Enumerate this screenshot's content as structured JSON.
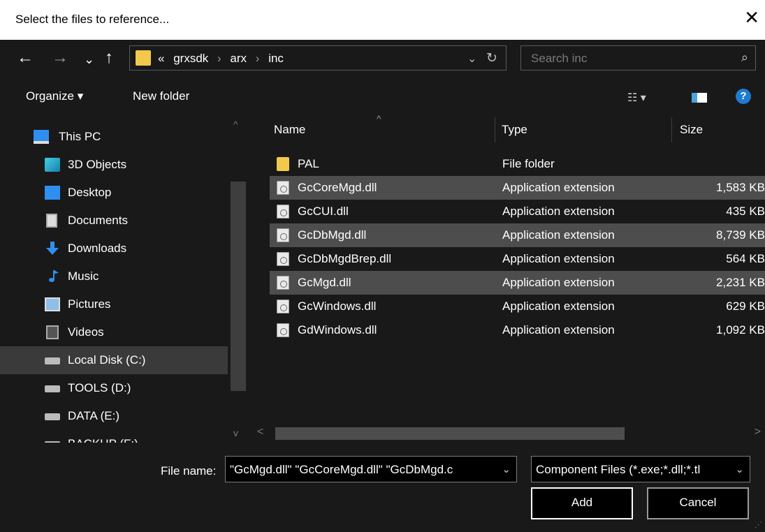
{
  "window": {
    "title": "Select the files to reference...",
    "close_icon": "close-icon"
  },
  "nav": {
    "back": "←",
    "forward": "→",
    "recent": "⌄",
    "up": "↑",
    "address": [
      "«",
      "grxsdk",
      "arx",
      "inc"
    ],
    "address_dropdown": "⌄",
    "refresh": "↻",
    "search_placeholder": "Search inc",
    "search_icon": "⌕"
  },
  "toolbar": {
    "organize": "Organize ▾",
    "new_folder": "New folder",
    "view_menu": "☷ ▾",
    "help": "?"
  },
  "sidebar": {
    "scroll_up": "^",
    "scroll_down": "v",
    "items": [
      {
        "label": "This PC",
        "icon": "computer-icon",
        "selected": false
      },
      {
        "label": "3D Objects",
        "icon": "3d-objects-icon",
        "selected": false
      },
      {
        "label": "Desktop",
        "icon": "desktop-icon",
        "selected": false
      },
      {
        "label": "Documents",
        "icon": "documents-icon",
        "selected": false
      },
      {
        "label": "Downloads",
        "icon": "downloads-icon",
        "selected": false
      },
      {
        "label": "Music",
        "icon": "music-icon",
        "selected": false
      },
      {
        "label": "Pictures",
        "icon": "pictures-icon",
        "selected": false
      },
      {
        "label": "Videos",
        "icon": "videos-icon",
        "selected": false
      },
      {
        "label": "Local Disk (C:)",
        "icon": "drive-icon",
        "selected": true
      },
      {
        "label": "TOOLS (D:)",
        "icon": "drive-icon",
        "selected": false
      },
      {
        "label": "DATA (E:)",
        "icon": "drive-icon",
        "selected": false
      },
      {
        "label": "BACKUP (F:)",
        "icon": "drive-icon",
        "selected": false
      }
    ]
  },
  "files": {
    "sort_indicator": "^",
    "columns": {
      "name": "Name",
      "type": "Type",
      "size": "Size"
    },
    "rows": [
      {
        "name": "PAL",
        "type": "File folder",
        "size": "",
        "icon": "folder-icon",
        "selected": false
      },
      {
        "name": "GcCoreMgd.dll",
        "type": "Application extension",
        "size": "1,583 KB",
        "icon": "dll-file-icon",
        "selected": true
      },
      {
        "name": "GcCUI.dll",
        "type": "Application extension",
        "size": "435 KB",
        "icon": "dll-file-icon",
        "selected": false
      },
      {
        "name": "GcDbMgd.dll",
        "type": "Application extension",
        "size": "8,739 KB",
        "icon": "dll-file-icon",
        "selected": true
      },
      {
        "name": "GcDbMgdBrep.dll",
        "type": "Application extension",
        "size": "564 KB",
        "icon": "dll-file-icon",
        "selected": false
      },
      {
        "name": "GcMgd.dll",
        "type": "Application extension",
        "size": "2,231 KB",
        "icon": "dll-file-icon",
        "selected": true
      },
      {
        "name": "GcWindows.dll",
        "type": "Application extension",
        "size": "629 KB",
        "icon": "dll-file-icon",
        "selected": false
      },
      {
        "name": "GdWindows.dll",
        "type": "Application extension",
        "size": "1,092 KB",
        "icon": "dll-file-icon",
        "selected": false
      }
    ],
    "scroll_left": "<",
    "scroll_right": ">"
  },
  "footer": {
    "file_name_label": "File name:",
    "file_name_value": "\"GcMgd.dll\" \"GcCoreMgd.dll\" \"GcDbMgd.c",
    "filter_value": "Component Files (*.exe;*.dll;*.tl",
    "dropdown_glyph": "⌄",
    "add_label": "Add",
    "cancel_label": "Cancel",
    "grip": "⋰"
  }
}
